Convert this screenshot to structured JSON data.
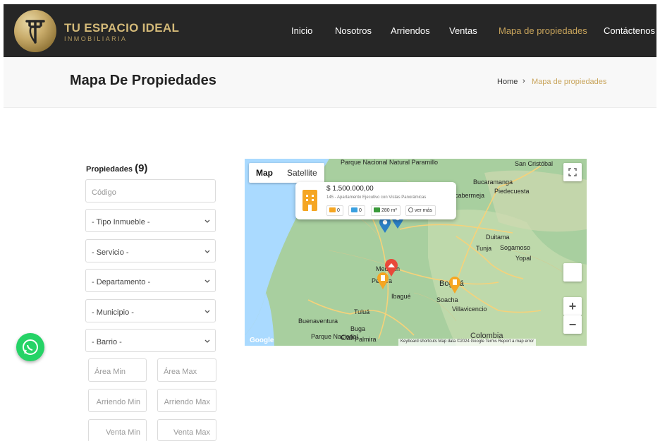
{
  "header": {
    "brand_name": "TU ESPACIO IDEAL",
    "brand_sub": "INMOBILIARIA",
    "nav": [
      {
        "label": "Inicio"
      },
      {
        "label": "Nosotros"
      },
      {
        "label": "Arriendos"
      },
      {
        "label": "Ventas"
      },
      {
        "label": "Mapa de propiedades",
        "active": true
      },
      {
        "label": "Contáctenos"
      }
    ]
  },
  "page": {
    "title": "Mapa De Propiedades",
    "breadcrumb": {
      "home": "Home",
      "separator": "›",
      "current": "Mapa de propiedades"
    }
  },
  "filters": {
    "label": "Propiedades",
    "count": "(9)",
    "codigo_placeholder": "Código",
    "tipo_inmueble": "- Tipo Inmueble -",
    "servicio": "- Servicio -",
    "departamento": "- Departamento -",
    "municipio": "- Municipio -",
    "barrio": "- Barrio -",
    "area_min": "Área Min",
    "area_max": "Área Max",
    "arriendo_min": "Arriendo Min",
    "arriendo_max": "Arriendo Max",
    "venta_min": "Venta Min",
    "venta_max": "Venta Max"
  },
  "map": {
    "type_map": "Map",
    "type_satellite": "Satellite",
    "zoom_in": "+",
    "zoom_out": "−",
    "google": "Google",
    "attribution": "Keyboard shortcuts   Map data ©2024 Google   Terms   Report a map error",
    "labels": {
      "parque_nacional": "Parque Nacional Natural Paramillo",
      "san_cristobal": "San Cristóbal",
      "bucaramanga": "Bucaramanga",
      "barrancabermeja": "cabermeja",
      "piedecuesta": "Piedecuesta",
      "duitama": "Duitama",
      "tunja": "Tunja",
      "sogamoso": "Sogamoso",
      "yopal": "Yopal",
      "medellin": "Medellín",
      "pereira": "Pereira",
      "ibague": "Ibagué",
      "bogota": "Bogotá",
      "soacha": "Soacha",
      "villavicencio": "Villavicencio",
      "tulua": "Tuluá",
      "buenaventura": "Buenaventura",
      "buga": "Buga",
      "cali": "Cali",
      "palmira": "Palmira",
      "parque_nacional_sur": "Parque Nacional",
      "colombia": "Colombia"
    },
    "popup": {
      "price": "$ 1.500.000,00",
      "description": "145 - Apartamento Ejecutivo con Vistas Panorámicas",
      "beds": "0",
      "baths": "0",
      "area": "280 m²",
      "view": "ver más"
    },
    "colors": {
      "water": "#aadaff",
      "land": "#a8cf9f",
      "road": "#f6d27a",
      "pin_orange": "#f5a623",
      "pin_blue": "#2b7fc4",
      "pin_red": "#e8493a"
    }
  },
  "whatsapp": {
    "icon": "whatsapp-icon"
  }
}
